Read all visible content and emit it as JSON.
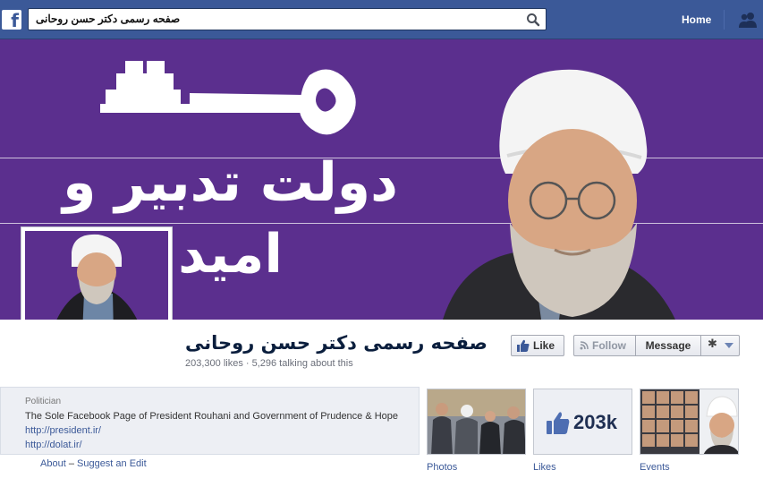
{
  "topbar": {
    "search_value": "صفحه رسمی دکتر حسن روحانی",
    "home_label": "Home"
  },
  "cover": {
    "slogan": "دولت تدبیر و امید",
    "background_color": "#5b2f8e"
  },
  "page": {
    "name": "صفحه رسمی دکتر حسن روحانی",
    "stats": "203,300 likes · 5,296 talking about this"
  },
  "actions": {
    "like_label": "Like",
    "follow_label": "Follow",
    "message_label": "Message",
    "gear_icon": "gear-icon"
  },
  "about": {
    "category": "Politician",
    "description": "The Sole Facebook Page of President Rouhani and Government of Prudence & Hope",
    "link1": "http://president.ir/",
    "link2": "http://dolat.ir/",
    "about_label": "About",
    "separator": "–",
    "suggest_label": "Suggest an Edit"
  },
  "apps": [
    {
      "label": "Photos"
    },
    {
      "label": "Likes",
      "count": "203k"
    },
    {
      "label": "Events"
    }
  ],
  "colors": {
    "brand_blue": "#3b5998",
    "link_blue": "#3b5998",
    "cover_purple": "#5b2f8e"
  }
}
